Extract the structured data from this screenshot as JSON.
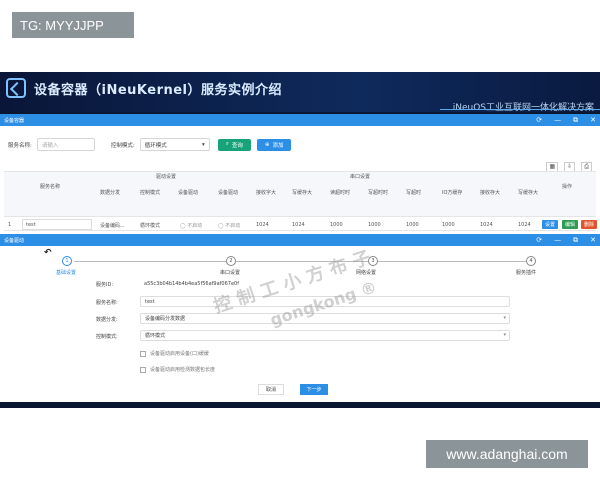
{
  "overlay_tags": {
    "top_left": "TG: MYYJJPP",
    "bottom_right": "www.adanghai.com"
  },
  "banner": {
    "title": "设备容器（iNeuKernel）服务实例介绍",
    "subtitle": "iNeuOS工业互联网一体化解决方案"
  },
  "window1": {
    "title": "设备容器",
    "controls": [
      "⟳",
      "—",
      "⧉",
      "✕"
    ],
    "search": {
      "service_name_label": "服务名称:",
      "service_name_placeholder": "请输入",
      "control_mode_label": "控制模式:",
      "control_mode_value": "循环模式",
      "query_button": "查询",
      "add_button": "添加"
    },
    "table": {
      "group_headers": {
        "driver": "驱动设置",
        "serial": "串口设置",
        "op": "操作"
      },
      "headers": [
        "服务名称",
        "数据分发",
        "控制模式",
        "设备驱动",
        "设备驱动",
        "接收字大",
        "写缓存大",
        "读超时时",
        "写超时时",
        "写超时",
        "IO方缓存",
        "接收存大",
        "写缓存大"
      ],
      "row": [
        "1",
        "test",
        "设备编码...",
        "循环模式",
        "不启动",
        "不启动",
        "1024",
        "1024",
        "1000",
        "1000",
        "1000",
        "1000",
        "1024",
        "1024"
      ],
      "row_buttons": [
        "设置",
        "编辑",
        "删除"
      ]
    }
  },
  "window2": {
    "title": "设备驱动",
    "controls": [
      "⟳",
      "—",
      "⧉",
      "✕"
    ],
    "back_icon": "back-arrow-icon",
    "steps": [
      {
        "num": "1",
        "label": "基础设置"
      },
      {
        "num": "2",
        "label": "串口设置"
      },
      {
        "num": "3",
        "label": "网络设置"
      },
      {
        "num": "4",
        "label": "服务插件"
      }
    ],
    "form": {
      "service_id_label": "服务ID:",
      "service_id_value": "a55c3b04b14b4b4ea5f56af9af067e0f",
      "service_name_label": "服务名称:",
      "service_name_value": "test",
      "data_dist_label": "数据分发:",
      "data_dist_value": "设备编码分发数据",
      "control_mode_label": "控制模式:",
      "control_mode_value": "循环模式",
      "check1": "设备驱动启用设备(口)缓缓",
      "check2": "设备驱动启用检测数据包长度"
    },
    "actions": {
      "cancel": "取消",
      "next": "下一步"
    }
  },
  "watermark": {
    "cn": "控 制 工 小 方 布 子",
    "en": "gongkong ®"
  },
  "colors": {
    "primary": "#2d8ee6",
    "query_green": "#17a37a",
    "delete_red": "#e2542b",
    "edit_green": "#2e9a55",
    "banner_bg": "#0b1630"
  }
}
